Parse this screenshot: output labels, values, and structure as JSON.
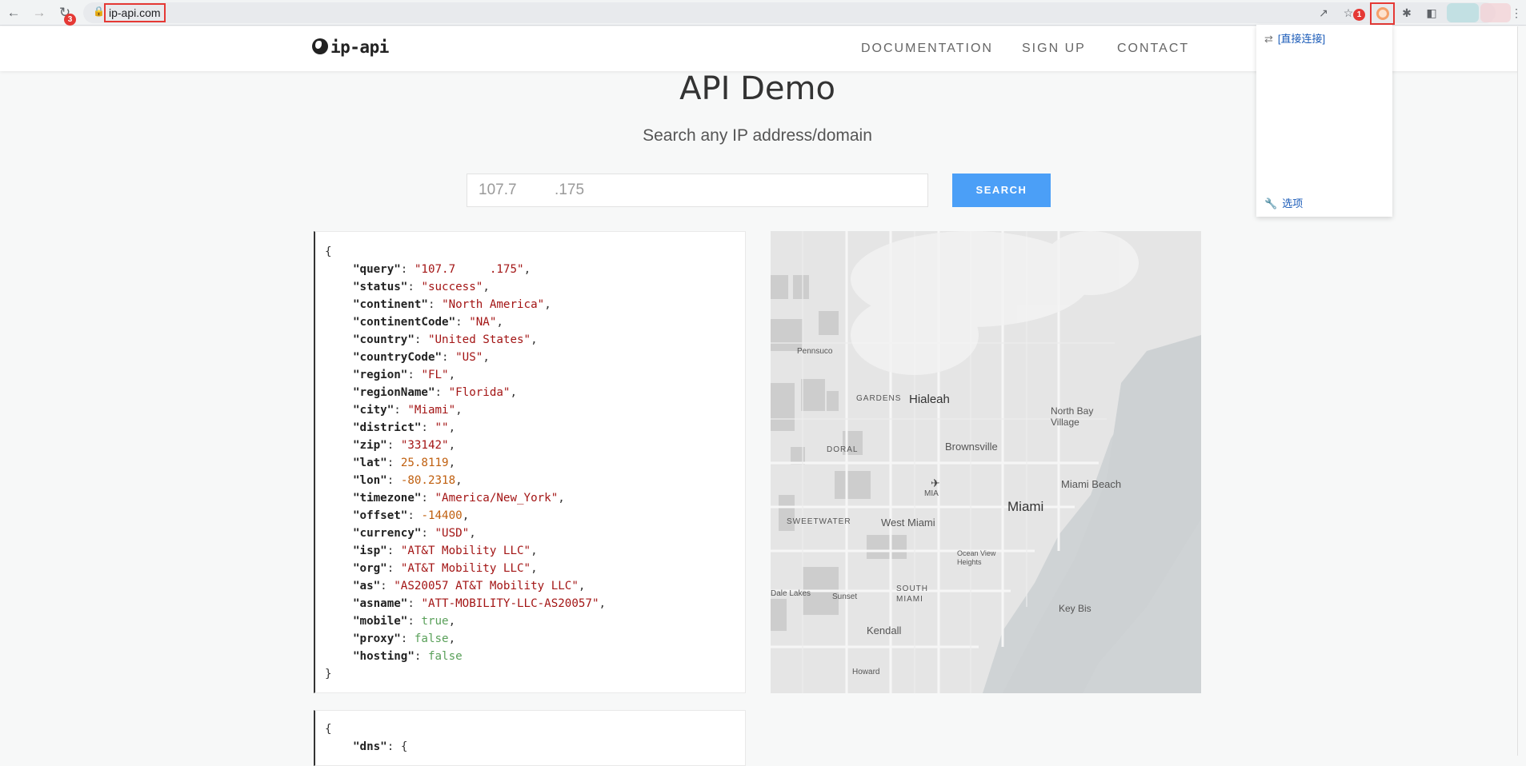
{
  "browser": {
    "url": "ip-api.com",
    "badges": {
      "reload_badge": "3",
      "ext_badge": "1"
    }
  },
  "header": {
    "logo_text": "ip-api",
    "nav": [
      "DOCUMENTATION",
      "SIGN UP",
      "CONTACT"
    ]
  },
  "main": {
    "title": "API Demo",
    "subtitle": "Search any IP address/domain",
    "search_value": "107.7     .175",
    "search_button": "SEARCH"
  },
  "json_result": {
    "open": "{",
    "close": "}",
    "lines": [
      {
        "key": "\"query\"",
        "val": "\"107.7     .175\"",
        "type": "s"
      },
      {
        "key": "\"status\"",
        "val": "\"success\"",
        "type": "s"
      },
      {
        "key": "\"continent\"",
        "val": "\"North America\"",
        "type": "s"
      },
      {
        "key": "\"continentCode\"",
        "val": "\"NA\"",
        "type": "s"
      },
      {
        "key": "\"country\"",
        "val": "\"United States\"",
        "type": "s"
      },
      {
        "key": "\"countryCode\"",
        "val": "\"US\"",
        "type": "s"
      },
      {
        "key": "\"region\"",
        "val": "\"FL\"",
        "type": "s"
      },
      {
        "key": "\"regionName\"",
        "val": "\"Florida\"",
        "type": "s"
      },
      {
        "key": "\"city\"",
        "val": "\"Miami\"",
        "type": "s"
      },
      {
        "key": "\"district\"",
        "val": "\"\"",
        "type": "s"
      },
      {
        "key": "\"zip\"",
        "val": "\"33142\"",
        "type": "s"
      },
      {
        "key": "\"lat\"",
        "val": "25.8119",
        "type": "n"
      },
      {
        "key": "\"lon\"",
        "val": "-80.2318",
        "type": "n"
      },
      {
        "key": "\"timezone\"",
        "val": "\"America/New_York\"",
        "type": "s"
      },
      {
        "key": "\"offset\"",
        "val": "-14400",
        "type": "n"
      },
      {
        "key": "\"currency\"",
        "val": "\"USD\"",
        "type": "s"
      },
      {
        "key": "\"isp\"",
        "val": "\"AT&T Mobility LLC\"",
        "type": "s"
      },
      {
        "key": "\"org\"",
        "val": "\"AT&T Mobility LLC\"",
        "type": "s"
      },
      {
        "key": "\"as\"",
        "val": "\"AS20057 AT&T Mobility LLC\"",
        "type": "s"
      },
      {
        "key": "\"asname\"",
        "val": "\"ATT-MOBILITY-LLC-AS20057\"",
        "type": "s"
      },
      {
        "key": "\"mobile\"",
        "val": "true",
        "type": "b"
      },
      {
        "key": "\"proxy\"",
        "val": "false",
        "type": "b"
      },
      {
        "key": "\"hosting\"",
        "val": "false",
        "type": "b",
        "last": true
      }
    ]
  },
  "json_result2": {
    "open": "{",
    "line1_key": "\"dns\"",
    "line1_val": "{"
  },
  "map": {
    "labels": [
      "Pennsuco",
      "GARDENS",
      "Hialeah",
      "North Bay Village",
      "DORAL",
      "Brownsville",
      "Miami Beach",
      "MIA",
      "Miami",
      "SWEETWATER",
      "West Miami",
      "Ocean View Heights",
      "Dale Lakes",
      "Sunset",
      "SOUTH MIAMI",
      "Key Bis",
      "Kendall",
      "Howard"
    ]
  },
  "popup": {
    "direct_label": "[直接连接]",
    "options_label": "选项"
  },
  "colors": {
    "accent": "#4b9ff7",
    "annotation": "#e53935"
  }
}
